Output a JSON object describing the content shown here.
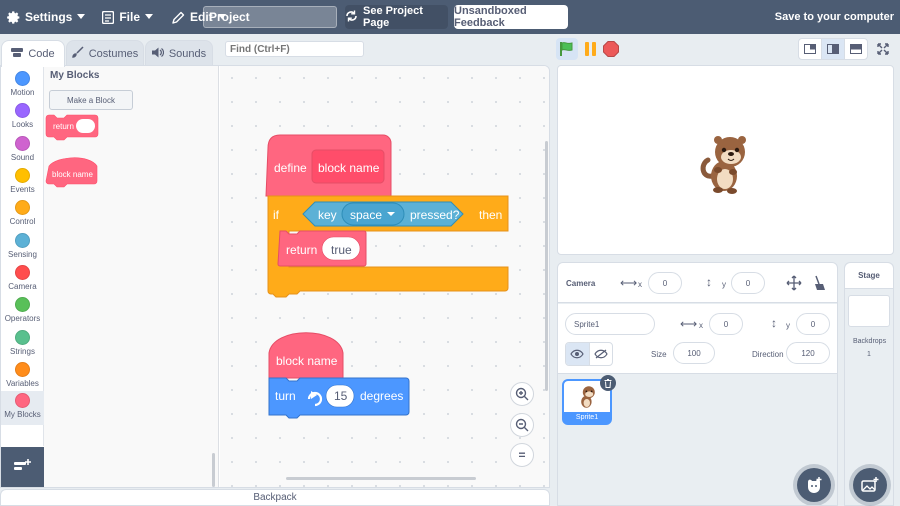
{
  "menu": {
    "settings": "Settings",
    "file": "File",
    "edit": "Edit",
    "project_title": "Project",
    "see_project_page": "See Project Page",
    "unsandboxed_feedback": "Unsandboxed Feedback",
    "save_to_computer": "Save to your computer"
  },
  "tabs": [
    {
      "label": "Code"
    },
    {
      "label": "Costumes"
    },
    {
      "label": "Sounds"
    }
  ],
  "find": {
    "placeholder": "Find (Ctrl+F)"
  },
  "categories": [
    {
      "label": "Motion",
      "color": "#4c97ff"
    },
    {
      "label": "Looks",
      "color": "#9966ff"
    },
    {
      "label": "Sound",
      "color": "#cf63cf"
    },
    {
      "label": "Events",
      "color": "#ffbf00"
    },
    {
      "label": "Control",
      "color": "#ffab19"
    },
    {
      "label": "Sensing",
      "color": "#5cb1d6"
    },
    {
      "label": "Camera",
      "color": "#ff4d4d"
    },
    {
      "label": "Operators",
      "color": "#59c059"
    },
    {
      "label": "Strings",
      "color": "#59c08e"
    },
    {
      "label": "Variables",
      "color": "#ff8c1a"
    },
    {
      "label": "My Blocks",
      "color": "#ff6680"
    }
  ],
  "flyout": {
    "title": "My Blocks",
    "make_block": "Make a Block",
    "return_block": "return",
    "block_name": "block name"
  },
  "script1": {
    "define": "define",
    "block_name": "block name",
    "if": "if",
    "key": "key",
    "key_value": "space",
    "pressed": "pressed?",
    "then": "then",
    "return": "return",
    "return_value": "true"
  },
  "script2": {
    "hat": "block name",
    "turn": "turn",
    "turn_value": "15",
    "degrees": "degrees"
  },
  "zoom": {
    "in": "+",
    "out": "−",
    "reset": "="
  },
  "backpack": "Backpack",
  "camera": {
    "label": "Camera",
    "x_label": "x",
    "x_value": "0",
    "y_label": "y",
    "y_value": "0"
  },
  "sprite": {
    "name": "Sprite1",
    "x_label": "x",
    "x_value": "0",
    "y_label": "y",
    "y_value": "0",
    "size_label": "Size",
    "size_value": "100",
    "direction_label": "Direction",
    "direction_value": "120"
  },
  "sprite_list": [
    {
      "name": "Sprite1"
    }
  ],
  "stage_pane": {
    "title": "Stage",
    "backdrops_label": "Backdrops",
    "backdrops_count": "1"
  },
  "colors": {
    "menu_bar": "#4c5c73",
    "motion": "#4c97ff",
    "control": "#ffab19",
    "sensing": "#5cb1d6",
    "my_blocks": "#ff6680",
    "green_flag": "#4cbf56",
    "stop": "#ec5959"
  }
}
